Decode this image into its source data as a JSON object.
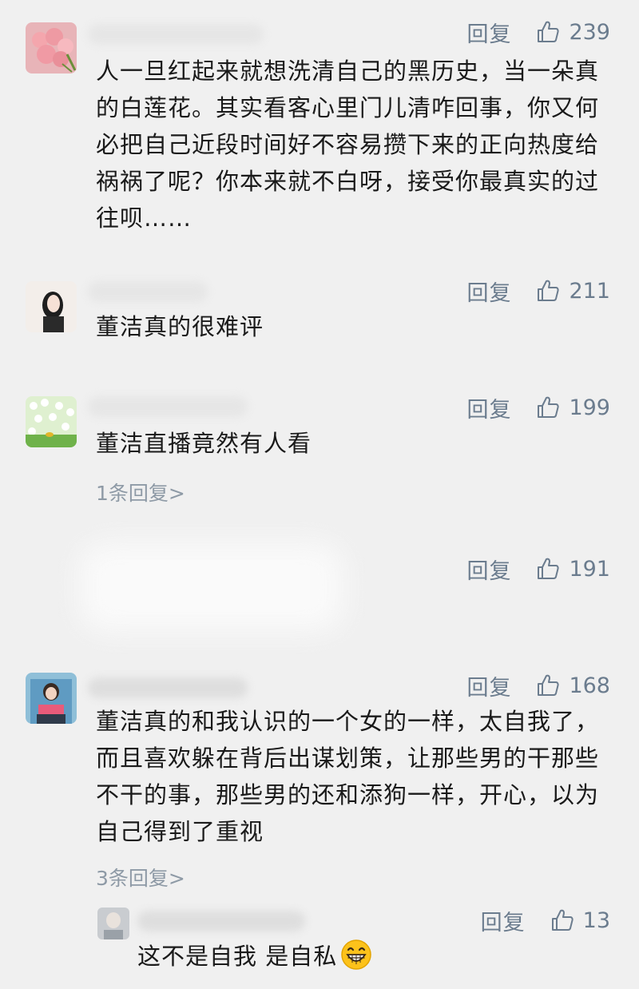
{
  "reply_label": "回复",
  "comments": [
    {
      "likes": "239",
      "text": "人一旦红起来就想洗清自己的黑历史，当一朵真的白莲花。其实看客心里门儿清咋回事，你又何必把自己近段时间好不容易攒下来的正向热度给祸祸了呢？你本来就不白呀，接受你最真实的过往呗……"
    },
    {
      "likes": "211",
      "text": "董洁真的很难评"
    },
    {
      "likes": "199",
      "text": "董洁直播竟然有人看",
      "more_replies": "1条回复>"
    },
    {
      "likes": "191",
      "text": ""
    },
    {
      "likes": "168",
      "text": "董洁真的和我认识的一个女的一样，太自我了，而且喜欢躲在背后出谋划策，让那些男的干那些不干的事，那些男的还和添狗一样，开心，以为自己得到了重视",
      "more_replies": "3条回复>"
    }
  ],
  "sub_reply": {
    "likes": "13",
    "text": "这不是自我 是自私",
    "emoji": "grinning-face-icon"
  },
  "colors": {
    "background": "#f0f0f0",
    "action": "#6b7c8e",
    "muted": "#8e9aa6",
    "text": "#1a1a1a"
  }
}
